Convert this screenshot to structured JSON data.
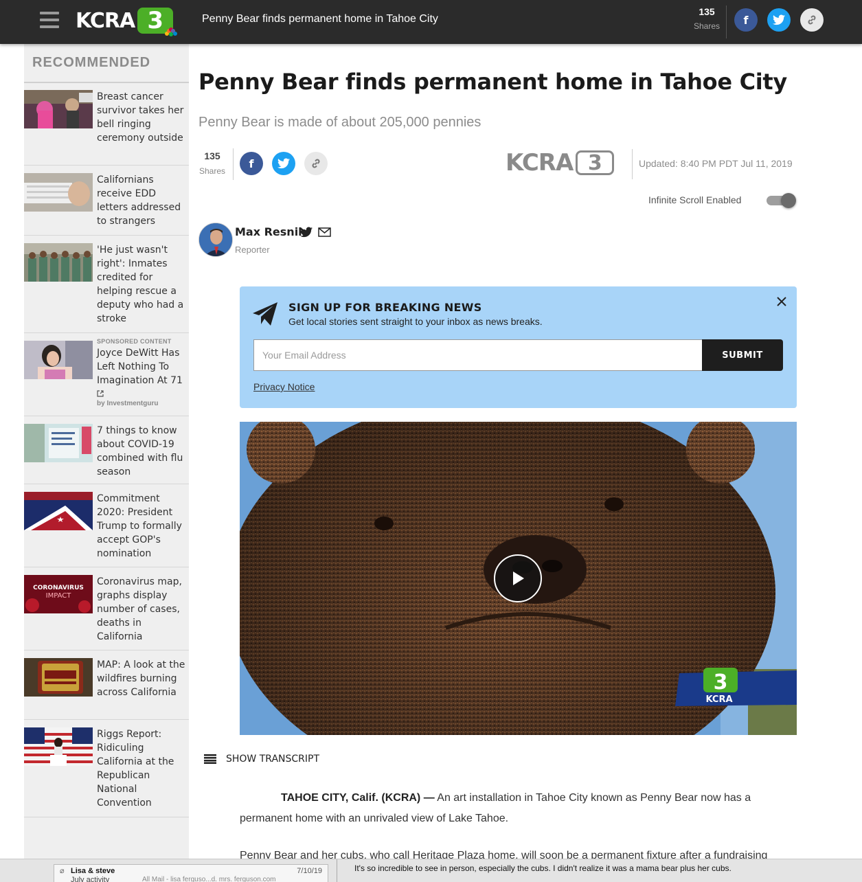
{
  "header": {
    "logo_text": "KCRA",
    "logo_number": "3",
    "title": "Penny Bear finds permanent home in Tahoe City",
    "shares_count": "135",
    "shares_label": "Shares"
  },
  "sidebar": {
    "heading": "RECOMMENDED",
    "items": [
      {
        "title": "Breast cancer survivor takes her bell ringing ceremony outside"
      },
      {
        "title": "Californians receive EDD letters addressed to strangers"
      },
      {
        "title": "'He just wasn't right': Inmates credited for helping rescue a deputy who had a stroke"
      },
      {
        "title": "Joyce DeWitt Has Left Nothing To Imagination At 71",
        "sponsored_label": "SPONSORED CONTENT",
        "by": "by Investmentguru"
      },
      {
        "title": "7 things to know about COVID-19 combined with flu season"
      },
      {
        "title": "Commitment 2020: President Trump to formally accept GOP's nomination"
      },
      {
        "title": "Coronavirus map, graphs display number of cases, deaths in California",
        "thumb_text_1": "CORONAVIRUS",
        "thumb_text_2": "IMPACT"
      },
      {
        "title": "MAP: A look at the wildfires burning across California"
      },
      {
        "title": "Riggs Report: Ridiculing California at the Republican National Convention"
      }
    ]
  },
  "article": {
    "headline": "Penny Bear finds permanent home in Tahoe City",
    "subhead": "Penny Bear is made of about 205,000 pennies",
    "shares_count": "135",
    "shares_label": "Shares",
    "station_logo_text": "KCRA",
    "station_logo_number": "3",
    "updated": "Updated: 8:40 PM PDT Jul 11, 2019",
    "infinite_scroll_label": "Infinite Scroll Enabled",
    "infinite_scroll_on": true,
    "author": {
      "name": "Max Resnik",
      "role": "Reporter"
    },
    "show_transcript": "SHOW TRANSCRIPT",
    "dateline": "TAHOE CITY, Calif. (KCRA) —",
    "para1": "An art installation in Tahoe City known as Penny Bear now has a permanent home with an unrivaled view of Lake Tahoe.",
    "para2": "Penny Bear and her cubs, who call Heritage Plaza home, will soon be a permanent fixture after a fundraising"
  },
  "newsletter": {
    "title": "SIGN UP FOR BREAKING NEWS",
    "description": "Get local stories sent straight to your inbox as news breaks.",
    "email_placeholder": "Your Email Address",
    "submit_label": "SUBMIT",
    "privacy_label": "Privacy Notice"
  },
  "video": {
    "bug_number": "3",
    "bug_text": "KCRA"
  },
  "bottom_overlay": {
    "from": "Lisa & steve",
    "date": "7/10/19",
    "subject": "July activity",
    "path": "All Mail - lisa ferguso...d. mrs. ferguson.com",
    "body": "It's so incredible to see in person, especially the cubs. I didn't realize it was a mama bear plus her cubs."
  },
  "colors": {
    "topbar": "#2b2b2b",
    "facebook": "#3b5998",
    "twitter": "#1da1f2",
    "newsletter_bg": "#a8d4f8",
    "kcra_green": "#4caf27"
  }
}
